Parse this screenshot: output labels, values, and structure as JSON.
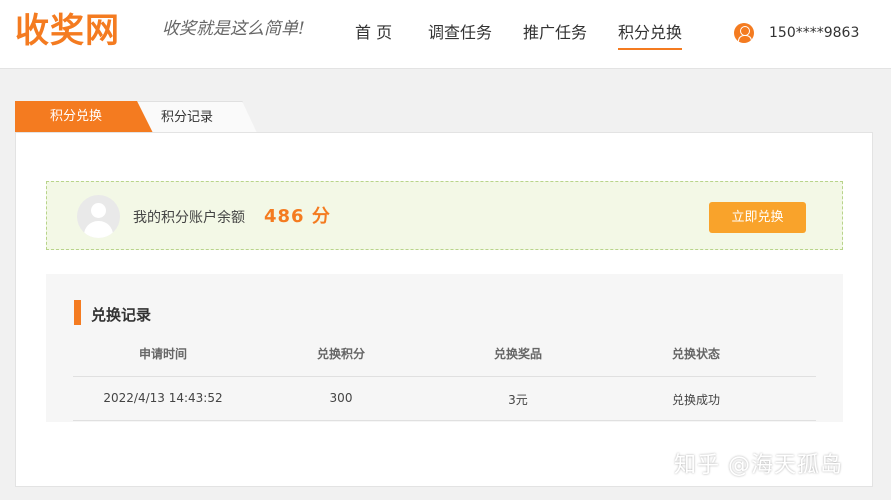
{
  "header": {
    "logo": "收奖网",
    "slogan": "收奖就是这么简单!",
    "nav": [
      {
        "label": "首 页"
      },
      {
        "label": "调查任务"
      },
      {
        "label": "推广任务"
      },
      {
        "label": "积分兑换"
      }
    ],
    "active_nav": "积分兑换",
    "user": {
      "icon": "user-icon",
      "name": "150****9863"
    }
  },
  "tabs": [
    {
      "label": "积分兑换",
      "active": true
    },
    {
      "label": "积分记录",
      "active": false
    }
  ],
  "balance": {
    "label": "我的积分账户余额",
    "value": "486 分",
    "button": "立即兑换"
  },
  "records": {
    "title": "兑换记录",
    "columns": [
      "申请时间",
      "兑换积分",
      "兑换奖品",
      "兑换状态"
    ],
    "rows": [
      [
        "2022/4/13 14:43:52",
        "300",
        "3元",
        "兑换成功"
      ]
    ]
  },
  "watermark": "知乎 @海天孤岛",
  "colors": {
    "accent": "#f47b20",
    "button": "#f9a32b",
    "balance_bg": "#f3f8e6",
    "balance_border": "#b8d48a"
  }
}
